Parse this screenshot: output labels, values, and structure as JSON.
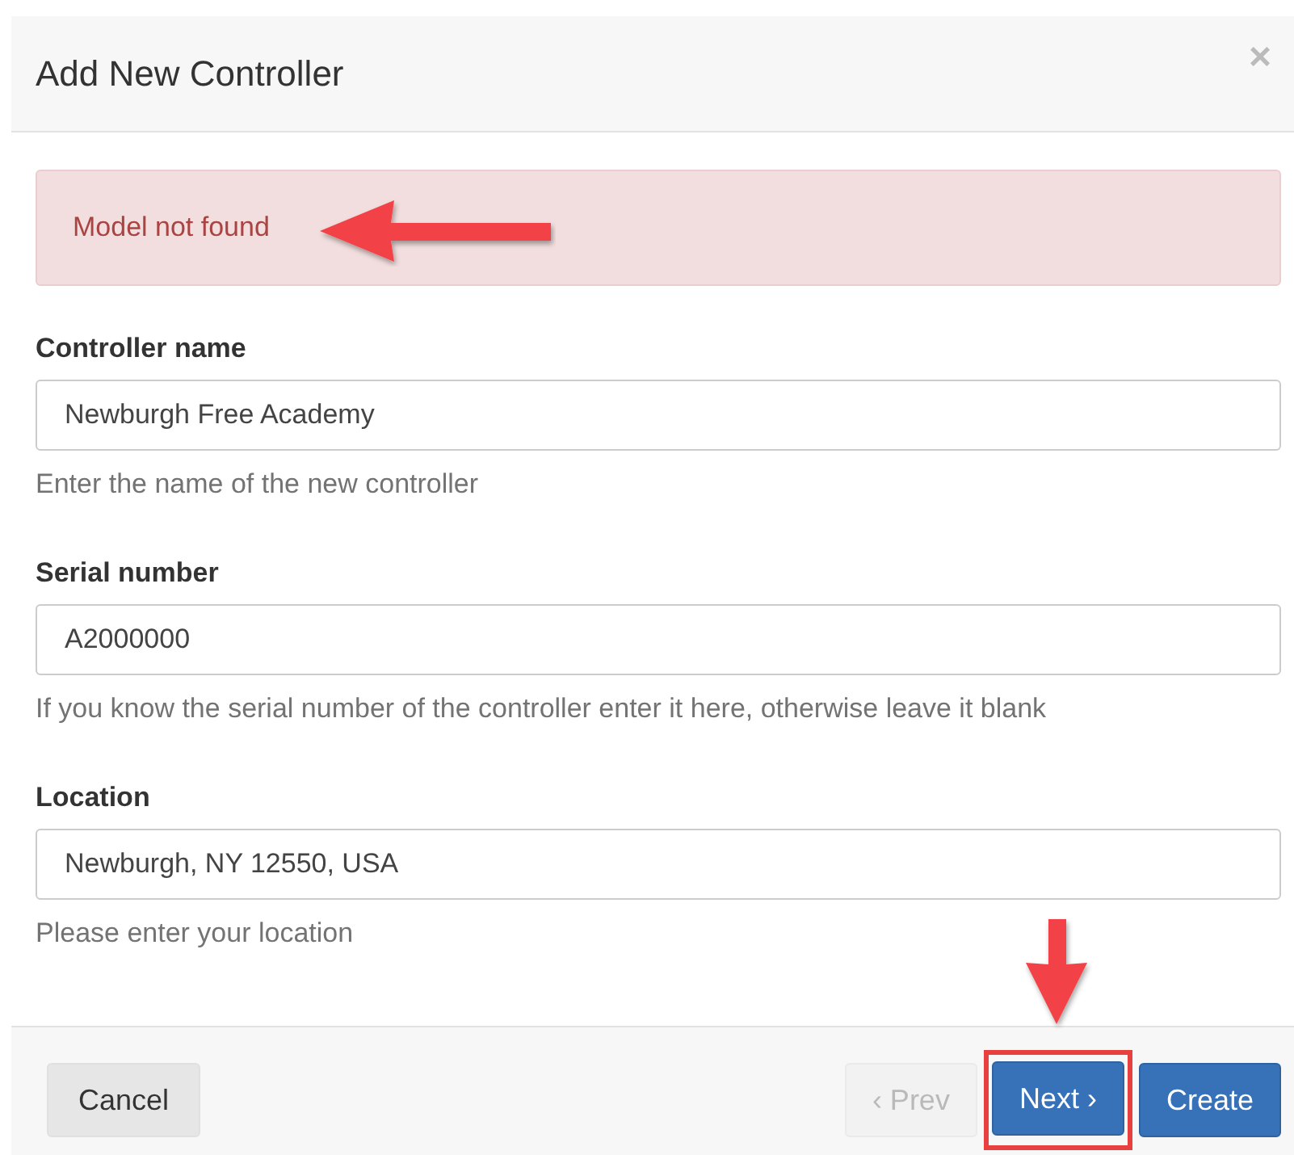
{
  "dialog": {
    "title": "Add New Controller",
    "close": "×"
  },
  "alert": {
    "message": "Model not found",
    "annotated": true
  },
  "fields": [
    {
      "label": "Controller name",
      "value": "Newburgh Free Academy",
      "help": "Enter the name of the new controller"
    },
    {
      "label": "Serial number",
      "value": "A2000000",
      "help": "If you know the serial number of the controller enter it here, otherwise leave it blank"
    },
    {
      "label": "Location",
      "value": "Newburgh, NY 12550, USA",
      "help": "Please enter your location"
    }
  ],
  "footer": {
    "buttons": [
      {
        "label": "Cancel",
        "kind": "default",
        "disabled": false,
        "highlighted": false
      },
      {
        "label": "‹ Prev",
        "kind": "default",
        "disabled": true,
        "highlighted": false
      },
      {
        "label": "Next ›",
        "kind": "primary",
        "disabled": false,
        "highlighted": true
      },
      {
        "label": "Create",
        "kind": "primary",
        "disabled": false,
        "highlighted": false
      }
    ]
  }
}
